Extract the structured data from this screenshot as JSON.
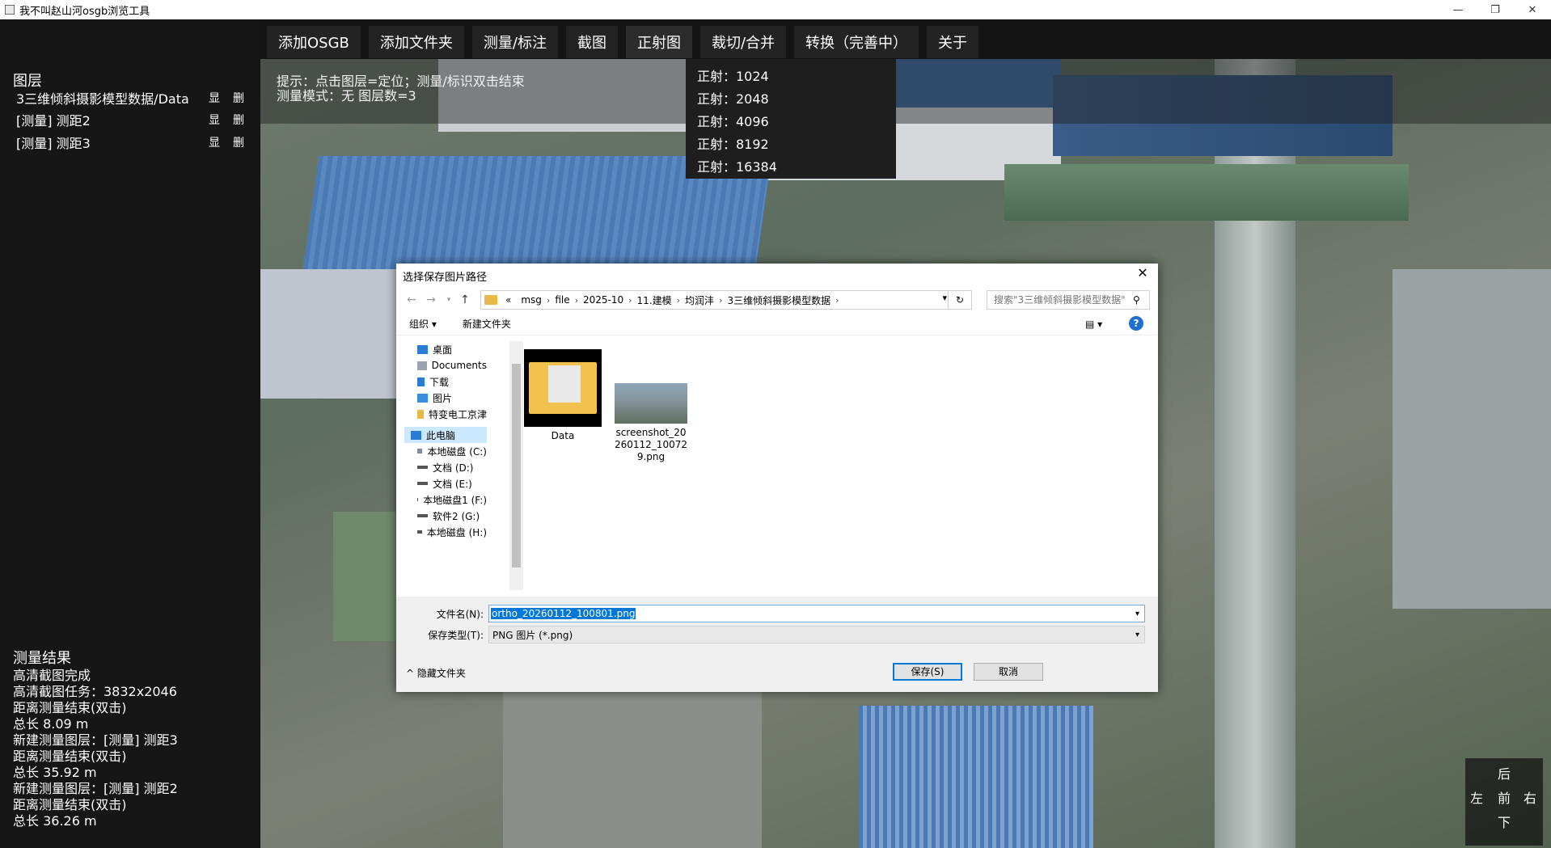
{
  "window": {
    "title": "我不叫赵山河osgb浏览工具",
    "controls": {
      "minimize": "—",
      "maximize": "❐",
      "close": "✕"
    }
  },
  "menu": [
    {
      "label": "添加OSGB"
    },
    {
      "label": "添加文件夹"
    },
    {
      "label": "测量/标注"
    },
    {
      "label": "截图"
    },
    {
      "label": "正射图"
    },
    {
      "label": "裁切/合并"
    },
    {
      "label": "转换（完善中）"
    },
    {
      "label": "关于"
    }
  ],
  "ortho_menu": [
    "正射：1024",
    "正射：2048",
    "正射：4096",
    "正射：8192",
    "正射：16384"
  ],
  "hint": {
    "line1": "提示：点击图层=定位；测量/标识双击结束",
    "line2": "测量模式：无   图层数=3"
  },
  "layers": {
    "title": "图层",
    "show_label": "显",
    "delete_label": "删",
    "items": [
      {
        "name": "3三维倾斜摄影模型数据/Data"
      },
      {
        "name": "[测量] 测距2"
      },
      {
        "name": "[测量] 测距3"
      }
    ]
  },
  "results": {
    "title": "测量结果",
    "lines": [
      "高清截图完成",
      "高清截图任务：3832x2046",
      "距离测量结束(双击)",
      "总长 8.09 m",
      "新建测量图层：[测量] 测距3",
      "距离测量结束(双击)",
      "总长 35.92 m",
      "新建测量图层：[测量] 测距2",
      "距离测量结束(双击)",
      "总长 36.26 m"
    ]
  },
  "nav_pad": {
    "back": "后",
    "left": "左",
    "front": "前",
    "right": "右",
    "down": "下"
  },
  "dialog": {
    "title": "选择保存图片路径",
    "breadcrumb": [
      "«",
      "msg",
      "file",
      "2025-10",
      "11.建模",
      "均润沣",
      "3三维倾斜摄影模型数据"
    ],
    "search_placeholder": "搜索\"3三维倾斜摄影模型数据\"",
    "organize": "组织 ▾",
    "new_folder": "新建文件夹",
    "nav_items": [
      {
        "label": "桌面",
        "icon": "desktop-icon"
      },
      {
        "label": "Documents",
        "icon": "documents-icon"
      },
      {
        "label": "下载",
        "icon": "download-icon"
      },
      {
        "label": "图片",
        "icon": "pictures-icon"
      },
      {
        "label": "特变电工京津",
        "icon": "folder-icon"
      },
      {
        "label": "此电脑",
        "icon": "computer-icon"
      },
      {
        "label": "本地磁盘 (C:)",
        "icon": "drive-icon"
      },
      {
        "label": "文档 (D:)",
        "icon": "drive-icon"
      },
      {
        "label": "文档 (E:)",
        "icon": "drive-icon"
      },
      {
        "label": "本地磁盘1 (F:)",
        "icon": "drive-icon"
      },
      {
        "label": "软件2 (G:)",
        "icon": "drive-icon"
      },
      {
        "label": "本地磁盘 (H:)",
        "icon": "drive-icon"
      }
    ],
    "files": [
      {
        "name": "Data",
        "type": "folder"
      },
      {
        "name": "screenshot_20260112_100729.png",
        "type": "image"
      }
    ],
    "filename_label": "文件名(N):",
    "filename_value": "ortho_20260112_100801.png",
    "filetype_label": "保存类型(T):",
    "filetype_value": "PNG 图片 (*.png)",
    "hide_folders": "隐藏文件夹",
    "save_button": "保存(S)",
    "cancel_button": "取消"
  }
}
